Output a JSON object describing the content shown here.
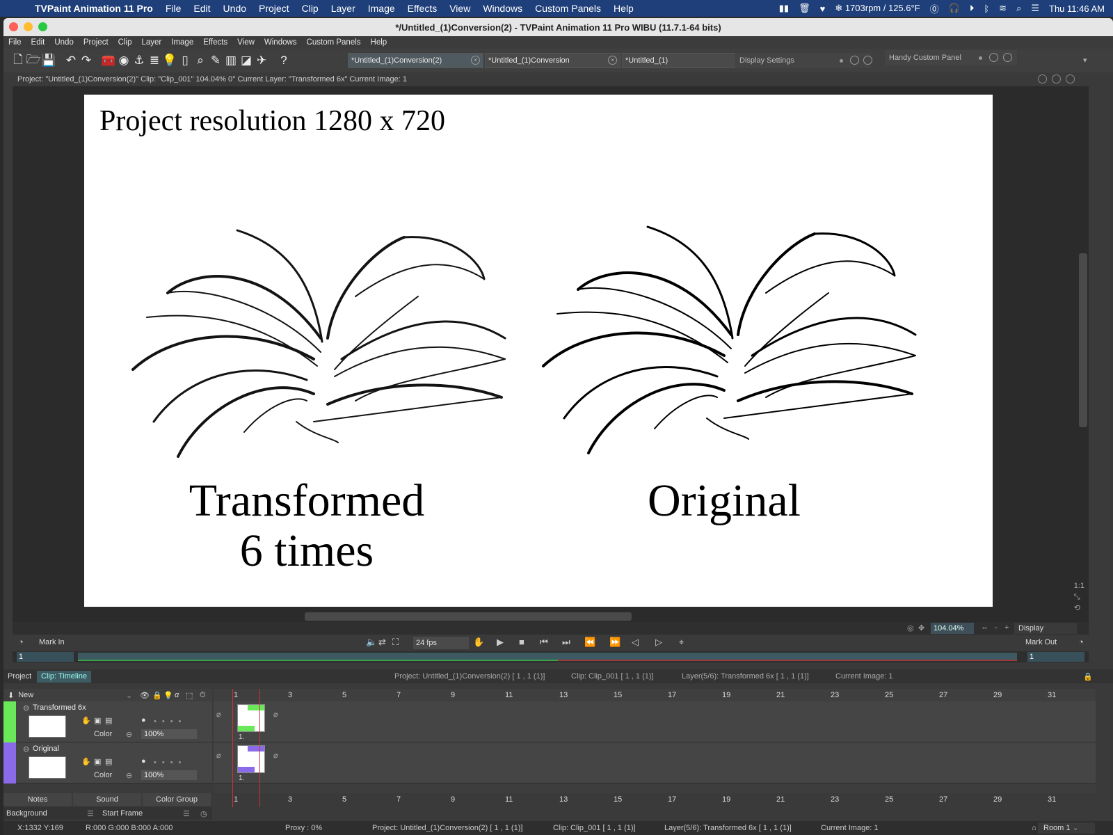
{
  "mac_menubar": {
    "app_name": "TVPaint Animation 11 Pro",
    "items": [
      "File",
      "Edit",
      "Undo",
      "Project",
      "Clip",
      "Layer",
      "Image",
      "Effects",
      "View",
      "Windows",
      "Custom Panels",
      "Help"
    ],
    "fan_status": "1703rpm / 125.6°F",
    "clock": "Thu  11:46 AM"
  },
  "window": {
    "title": "*/Untitled_(1)Conversion(2) - TVPaint Animation 11 Pro WIBU (11.7.1-64 bits)"
  },
  "app_menubar": {
    "items": [
      "File",
      "Edit",
      "Undo",
      "Project",
      "Clip",
      "Layer",
      "Image",
      "Effects",
      "View",
      "Windows",
      "Custom Panels",
      "Help"
    ]
  },
  "doc_tabs": [
    "*Untitled_(1)Conversion(2)",
    "*Untitled_(1)Conversion",
    "*Untitled_(1)"
  ],
  "panels": {
    "display_settings": "Display Settings",
    "handy_custom_panel": "Handy Custom Panel"
  },
  "infobar": {
    "text": "Project:  \"Untitled_(1)Conversion(2)\"  Clip: \"Clip_001\"   104.04%   0°  Current Layer: \"Transformed 6x\"  Current Image: 1"
  },
  "canvas": {
    "title": "Project resolution 1280 x 720",
    "left_label_line1": "Transformed",
    "left_label_line2": "6 times",
    "right_label": "Original"
  },
  "zoombar": {
    "zoom": "104.04%",
    "display": "Display"
  },
  "playbar": {
    "mark_in": "Mark In",
    "mark_out": "Mark Out",
    "fps": "24 fps",
    "in_value": "1",
    "out_value": "1"
  },
  "timeline": {
    "tab_project": "Project",
    "tab_clip": "Clip: Timeline",
    "info_project": "Project: Untitled_(1)Conversion(2) [ 1 , 1  (1)]",
    "info_clip": "Clip: Clip_001 [ 1 , 1  (1)]",
    "info_layer": "Layer(5/6): Transformed 6x [ 1 , 1  (1)]",
    "info_image": "Current Image: 1",
    "new_label": "New",
    "frame_numbers": [
      "1",
      "3",
      "5",
      "7",
      "9",
      "11",
      "13",
      "15",
      "17",
      "19",
      "21",
      "23",
      "25",
      "27",
      "29",
      "31"
    ],
    "layers": [
      {
        "name": "Transformed 6x",
        "color": "#6be85a",
        "mode": "Color",
        "opacity": "100%",
        "frame_label": "1."
      },
      {
        "name": "Original",
        "color": "#8a6ae8",
        "mode": "Color",
        "opacity": "100%",
        "frame_label": "1."
      }
    ],
    "footer_tabs": [
      "Notes",
      "Sound",
      "Color Group"
    ],
    "background": "Background",
    "start_frame": "Start Frame"
  },
  "statusbar": {
    "coords": "X:1332  Y:169",
    "rgba": "R:000 G:000 B:000 A:000",
    "proxy": "Proxy : 0%",
    "project": "Project: Untitled_(1)Conversion(2) [ 1 , 1  (1)]",
    "clip": "Clip: Clip_001 [ 1 , 1  (1)]",
    "layer": "Layer(5/6): Transformed 6x [ 1 , 1  (1)]",
    "image": "Current Image: 1",
    "room": "Room 1"
  }
}
